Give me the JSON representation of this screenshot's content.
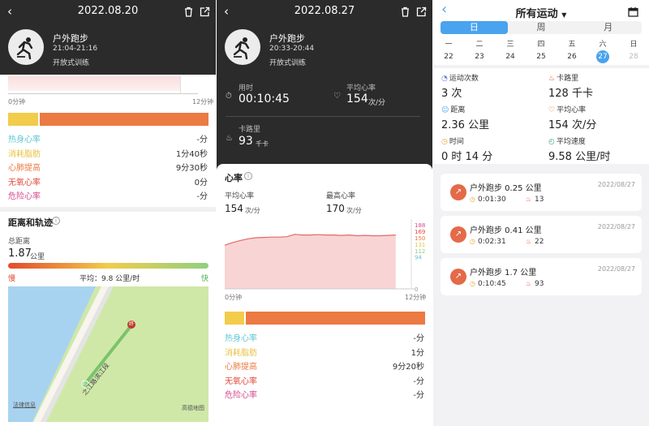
{
  "colors": {
    "accent_blue": "#4aa3ef",
    "orange": "#ec7a43",
    "yellow": "#f2cc4b",
    "green": "#8fd07f",
    "red": "#e24a2c",
    "hr_fill": "#f6c9c9",
    "dark_bg": "#2b2b2b"
  },
  "panel1": {
    "date": "2022.08.20",
    "activity_title": "户外跑步",
    "time_range": "21:04-21:16",
    "training_type": "开放式训练",
    "axis_start": "0分钟",
    "axis_end": "12分钟",
    "zones": [
      {
        "label": "热身心率",
        "value": "-分",
        "color": "#5ec6d2"
      },
      {
        "label": "消耗脂肪",
        "value": "1分40秒",
        "color": "#e8c242"
      },
      {
        "label": "心肺提高",
        "value": "9分30秒",
        "color": "#ec7a43"
      },
      {
        "label": "无氧心率",
        "value": "0分",
        "color": "#e2493a"
      },
      {
        "label": "危险心率",
        "value": "-分",
        "color": "#d64a8e"
      }
    ],
    "zone_bar": [
      0.15,
      0.85
    ],
    "distance_section_title": "距离和轨迹",
    "total_distance_label": "总距离",
    "total_distance_value": "1.87",
    "total_distance_unit": "公里",
    "pace_slow": "慢",
    "pace_fast": "快",
    "pace_avg": "平均：9.8 公里/时",
    "map_road_label": "之江路滨江段",
    "map_legal": "法律信息",
    "map_brand": "高德地图",
    "map_start_marker": "起",
    "map_end_marker": "终"
  },
  "panel2": {
    "date": "2022.08.27",
    "activity_title": "户外跑步",
    "time_range": "20:33-20:44",
    "training_type": "开放式训练",
    "duration_label": "用时",
    "duration_value": "00:10:45",
    "avg_hr_label": "平均心率",
    "avg_hr_value": "154",
    "avg_hr_unit": "次/分",
    "calories_label": "卡路里",
    "calories_value": "93",
    "calories_unit": "千卡",
    "hr_section_title": "心率",
    "hr_avg_label": "平均心率",
    "hr_avg_value": "154",
    "hr_avg_unit": "次/分",
    "hr_max_label": "最高心率",
    "hr_max_value": "170",
    "hr_max_unit": "次/分",
    "axis_start": "0分钟",
    "axis_end": "12分钟",
    "zones": [
      {
        "label": "热身心率",
        "value": "-分",
        "color": "#5ec6d2"
      },
      {
        "label": "消耗脂肪",
        "value": "1分",
        "color": "#e8c242"
      },
      {
        "label": "心肺提高",
        "value": "9分20秒",
        "color": "#ec7a43"
      },
      {
        "label": "无氧心率",
        "value": "-分",
        "color": "#e2493a"
      },
      {
        "label": "危险心率",
        "value": "-分",
        "color": "#d64a8e"
      }
    ],
    "zone_bar": [
      0.1,
      0.9
    ]
  },
  "chart_data": {
    "type": "area",
    "title": "心率",
    "xlabel": "",
    "ylabel": "",
    "x_tick_labels": [
      "0分钟",
      "12分钟"
    ],
    "y_tick_labels": [
      "188",
      "169",
      "150",
      "131",
      "112",
      "94",
      "0"
    ],
    "ylim": [
      0,
      200
    ],
    "x": [
      0,
      0.5,
      1,
      1.5,
      2,
      2.5,
      3,
      3.5,
      4,
      4.5,
      5,
      5.5,
      6,
      6.5,
      7,
      7.5,
      8,
      8.5,
      9,
      9.5,
      10,
      10.5,
      11
    ],
    "series": [
      {
        "values": [
          128,
          136,
          142,
          147,
          150,
          151,
          152,
          152,
          153,
          160,
          158,
          158,
          159,
          158,
          158,
          157,
          158,
          156,
          157,
          156,
          156,
          157,
          158
        ]
      }
    ],
    "legend": "none",
    "grid": false
  },
  "panel3": {
    "title": "所有运动",
    "tabs": [
      "日",
      "周",
      "月"
    ],
    "active_tab": 0,
    "weekdays": [
      "一",
      "二",
      "三",
      "四",
      "五",
      "六",
      "日"
    ],
    "dates": [
      "22",
      "23",
      "24",
      "25",
      "26",
      "27",
      "28"
    ],
    "selected_date_index": 5,
    "stats": [
      {
        "label": "运动次数",
        "value": "3 次",
        "icon": "cycle-icon"
      },
      {
        "label": "卡路里",
        "value": "128 千卡",
        "icon": "flame-icon"
      },
      {
        "label": "距离",
        "value": "2.36 公里",
        "icon": "person-icon"
      },
      {
        "label": "平均心率",
        "value": "154 次/分",
        "icon": "heart-icon"
      },
      {
        "label": "时间",
        "value": "0 时 14 分",
        "icon": "clock-icon"
      },
      {
        "label": "平均速度",
        "value": "9.58 公里/时",
        "icon": "speed-icon"
      }
    ],
    "records": [
      {
        "title": "户外跑步 0.25 公里",
        "date": "2022/08/27",
        "duration": "0:01:30",
        "calories": "13"
      },
      {
        "title": "户外跑步 0.41 公里",
        "date": "2022/08/27",
        "duration": "0:02:31",
        "calories": "22"
      },
      {
        "title": "户外跑步 1.7 公里",
        "date": "2022/08/27",
        "duration": "0:10:45",
        "calories": "93"
      }
    ]
  }
}
